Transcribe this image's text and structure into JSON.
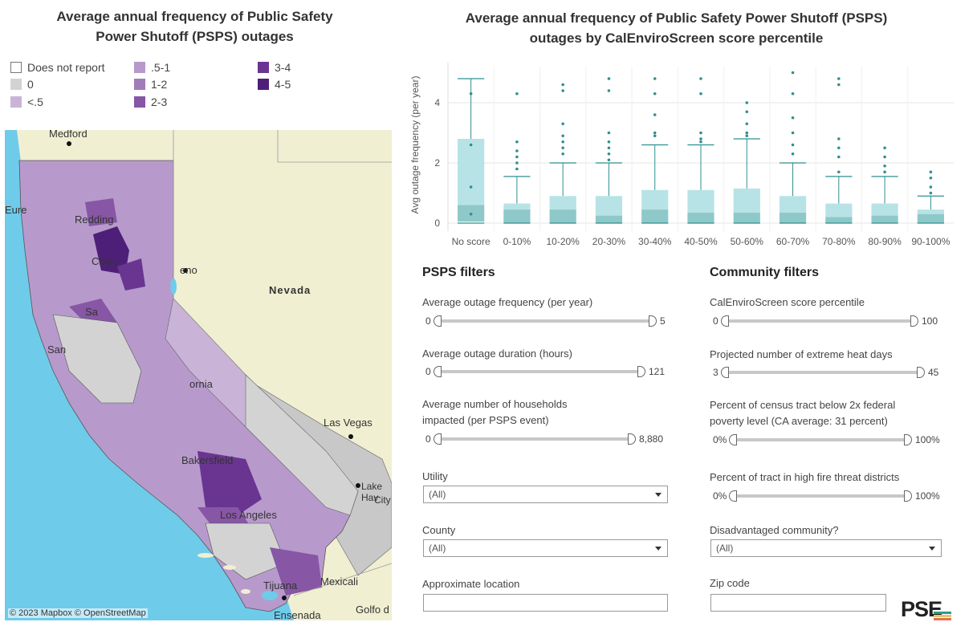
{
  "map": {
    "title_line1": "Average annual frequency of Public Safety",
    "title_line2": "Power Shutoff (PSPS) outages",
    "legend": [
      {
        "label": "Does not report",
        "color": "#ffffff"
      },
      {
        "label": "0",
        "color": "#d3d3d3"
      },
      {
        "label": "<.5",
        "color": "#c9b4d8"
      },
      {
        "label": ".5-1",
        "color": "#b79acb"
      },
      {
        "label": "1-2",
        "color": "#a27cba"
      },
      {
        "label": "2-3",
        "color": "#8756a5"
      },
      {
        "label": "3-4",
        "color": "#6a3591"
      },
      {
        "label": "4-5",
        "color": "#4e1f78"
      }
    ],
    "places": {
      "medford": "Medford",
      "eureka": "Eure",
      "redding": "Redding",
      "chico": "Chico",
      "reno": "eno",
      "sacramento": "Sa",
      "san": "San",
      "nevada": "Nevada",
      "california": "ornia",
      "las_vegas": "Las Vegas",
      "bakersfield": "Bakersfield",
      "lake_havasu": "Lake Hav",
      "city": "City",
      "los_angeles": "Los Angeles",
      "tijuana": "Tijuana",
      "mexicali": "Mexicali",
      "ensenada": "Ensenada",
      "golfo": "Golfo d"
    },
    "attribution": "© 2023 Mapbox  © OpenStreetMap"
  },
  "box": {
    "title_line1": "Average annual frequency of Public Safety Power Shutoff (PSPS)",
    "title_line2": "outages by CalEnviroScreen score percentile"
  },
  "chart_data": {
    "type": "box",
    "ylabel": "Avg outage frequency (per year)",
    "xlabel": "",
    "ylim": [
      0,
      5
    ],
    "yticks": [
      0,
      2,
      4
    ],
    "categories": [
      "No score",
      "0-10%",
      "10-20%",
      "20-30%",
      "30-40%",
      "40-50%",
      "50-60%",
      "60-70%",
      "70-80%",
      "80-90%",
      "90-100%"
    ],
    "whisker_low": [
      0,
      0,
      0,
      0,
      0,
      0,
      0,
      0,
      0,
      0,
      0
    ],
    "q1": [
      0.05,
      0.0,
      0.0,
      0.0,
      0.0,
      0.0,
      0.0,
      0.0,
      0.0,
      0.0,
      0.0
    ],
    "median": [
      0.6,
      0.45,
      0.45,
      0.25,
      0.45,
      0.35,
      0.35,
      0.35,
      0.2,
      0.25,
      0.3
    ],
    "q3": [
      2.8,
      0.65,
      0.9,
      0.9,
      1.1,
      1.1,
      1.15,
      0.9,
      0.65,
      0.65,
      0.45
    ],
    "whisker_high": [
      4.8,
      1.55,
      2.0,
      2.0,
      2.6,
      2.6,
      2.8,
      2.0,
      1.55,
      1.55,
      0.9
    ],
    "outliers": [
      [
        4.3,
        2.6,
        1.2,
        0.3
      ],
      [
        4.3,
        2.7,
        2.4,
        2.2,
        2.0,
        1.8
      ],
      [
        4.6,
        4.4,
        3.3,
        2.9,
        2.7,
        2.5,
        2.3
      ],
      [
        4.8,
        4.4,
        3.0,
        2.7,
        2.5,
        2.3,
        2.1
      ],
      [
        4.8,
        4.3,
        3.6,
        3.0,
        2.9
      ],
      [
        4.8,
        4.3,
        3.0,
        2.8,
        2.7
      ],
      [
        4.0,
        3.7,
        3.3,
        3.0,
        2.9
      ],
      [
        5.0,
        4.3,
        3.5,
        3.0,
        2.6,
        2.3
      ],
      [
        4.8,
        4.6,
        2.8,
        2.5,
        2.2,
        1.7
      ],
      [
        2.5,
        2.2,
        1.9,
        1.7
      ],
      [
        1.7,
        1.5,
        1.2,
        1.0
      ]
    ],
    "box_color": "#b7e3e6",
    "median_color": "#8fc8c8",
    "point_color": "#2f8f8f"
  },
  "pspsfilters": {
    "title": "PSPS filters",
    "freq": {
      "label": "Average outage frequency (per year)",
      "min": "0",
      "max": "5"
    },
    "duration": {
      "label": "Average outage duration (hours)",
      "min": "0",
      "max": "121"
    },
    "households": {
      "label1": "Average number of households",
      "label2": "impacted (per PSPS event)",
      "min": "0",
      "max": "8,880"
    },
    "utility": {
      "label": "Utility",
      "value": "(All)"
    },
    "county": {
      "label": "County",
      "value": "(All)"
    },
    "location": {
      "label": "Approximate location",
      "value": ""
    }
  },
  "community": {
    "title": "Community filters",
    "ces": {
      "label": "CalEnviroScreen score percentile",
      "min": "0",
      "max": "100"
    },
    "heat": {
      "label": "Projected number of extreme heat days",
      "min": "3",
      "max": "45"
    },
    "poverty": {
      "label1": "Percent of census tract below 2x federal",
      "label2": "poverty level (CA average: 31 percent)",
      "min": "0%",
      "max": "100%"
    },
    "fire": {
      "label": "Percent of tract in high fire threat districts",
      "min": "0%",
      "max": "100%"
    },
    "disadv": {
      "label": "Disadvantaged community?",
      "value": "(All)"
    },
    "zip": {
      "label": "Zip code",
      "value": ""
    }
  },
  "logo": "PSE"
}
